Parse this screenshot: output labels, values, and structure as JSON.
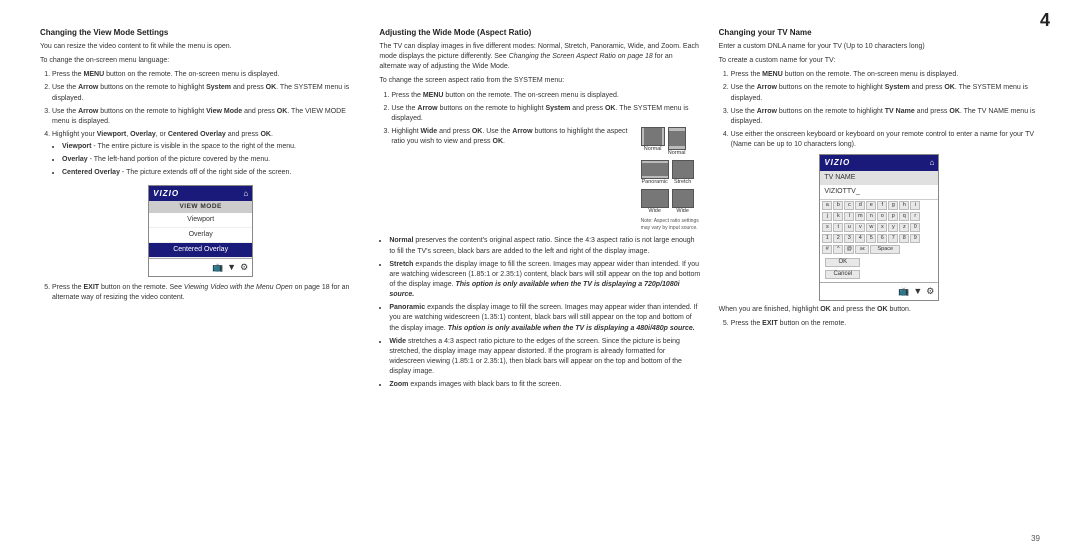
{
  "page": {
    "number": "4",
    "bottom_number": "39"
  },
  "col1": {
    "title": "Changing the View Mode Settings",
    "intro": "You can resize the video content to fit while the menu is open.",
    "change_lang": "To change the on-screen menu language:",
    "steps": [
      {
        "text": "Press the ",
        "bold": "MENU",
        "text2": " button on the remote. The on-screen menu is displayed."
      },
      {
        "text": "Use the ",
        "bold": "Arrow",
        "text2": " buttons on the remote to highlight ",
        "bold2": "System",
        "text3": " and press ",
        "bold3": "OK",
        "text4": ". The SYSTEM menu is displayed."
      },
      {
        "text": "Use the ",
        "bold": "Arrow",
        "text2": " buttons on the remote to highlight ",
        "bold2": "View Mode",
        "text3": " and press ",
        "bold3": "OK",
        "text4": ". The VIEW MODE menu is displayed."
      },
      {
        "text": "Highlight your ",
        "bold": "Viewport",
        "text2": ", ",
        "bold2": "Overlay",
        "text3": ", or ",
        "bold3": "Centered Overlay",
        "text4": " and press ",
        "bold4": "OK",
        "text5": "."
      }
    ],
    "bullets": [
      {
        "bold": "Viewport",
        "text": " - The entire picture is visible in the space to the right of the menu."
      },
      {
        "bold": "Overlay",
        "text": " - The left-hand portion of the picture covered by the menu."
      },
      {
        "bold": "Centered Overlay",
        "text": " - The picture extends off of the right side of the screen."
      }
    ],
    "step5": {
      "text": "Press the ",
      "bold": "EXIT",
      "text2": " button on the remote. See ",
      "italic": "Viewing Video with the Menu Open",
      "text3": " on page 18 for an alternate way of resizing the video content."
    },
    "menu": {
      "logo": "VIZIO",
      "title": "VIEW MODE",
      "items": [
        "Viewport",
        "Overlay",
        "Centered Overlay"
      ],
      "selected": "Centered Overlay"
    }
  },
  "col2": {
    "title": "Adjusting the Wide Mode (Aspect Ratio)",
    "intro": "The TV can display images in five different modes: Normal, Stretch, Panoramic, Wide, and Zoom. Each mode displays the picture differently. See Changing the Screen Aspect Ratio on page 18 for an alternate way of adjusting the Wide Mode.",
    "change_lang": "To change the screen aspect ratio from the SYSTEM menu:",
    "steps": [
      {
        "text": "Press the ",
        "bold": "MENU",
        "text2": " button on the remote. The on-screen menu is displayed."
      },
      {
        "text": "Use the ",
        "bold": "Arrow",
        "text2": " buttons on the remote to highlight ",
        "bold2": "System",
        "text3": " and press ",
        "bold3": "OK",
        "text4": ". The SYSTEM menu is displayed."
      },
      {
        "text": "Highlight ",
        "bold": "Wide",
        "text2": " and press ",
        "bold2": "OK",
        "text3": ". Use the ",
        "bold3": "Arrow",
        "text4": " buttons to highlight the aspect ratio you wish to view and press ",
        "bold4": "OK",
        "text5": "."
      }
    ],
    "bullets": [
      {
        "bold": "Normal",
        "text": " preserves the content's original aspect ratio. Since the 4:3 aspect ratio is not large enough to fill the TV's screen, black bars are added to the left and right of the display image."
      },
      {
        "bold": "Stretch",
        "text": " expands the display image to fill the screen. Images may appear wider than intended. If you are watching widescreen (1.85:1 or 2.35:1) content, black bars will still appear on the top and bottom of the display image. This option is only available when the TV is displaying a 720p/1080i source."
      },
      {
        "bold": "Panoramic",
        "text": " expands the display image to fill the screen. Images may appear wider than intended. If you are watching widescreen (1.35:1) content, black bars will still appear on the top and bottom of the display image. This option is only available when the TV is displaying a 480i/480p source."
      },
      {
        "bold": "Wide",
        "text": " stretches a 4:3 aspect ratio picture to the edges of the screen. Since the picture is being stretched, the display image may appear distorted. If the program is already formatted for widescreen viewing (1.85:1 or 2.35:1), then black bars will appear on the top and bottom of the display image."
      },
      {
        "bold": "Zoom",
        "text": " expands images with black bars to fit the screen."
      }
    ],
    "note": "Note: Aspect ratio settings may vary by input source.",
    "aspect_modes": [
      {
        "label": "Normal",
        "type": "normal"
      },
      {
        "label": "Normal",
        "type": "normal-tall"
      },
      {
        "label": "Panoramic",
        "type": "wide"
      },
      {
        "label": "Stretch",
        "type": "wide"
      },
      {
        "label": "Wide",
        "type": "wide"
      },
      {
        "label": "Wide",
        "type": "wide"
      }
    ]
  },
  "col3": {
    "title": "Changing your TV Name",
    "intro": "Enter a custom DNLA name for your TV (Up to 10 characters long)",
    "change_lang": "To create a custom name for your TV:",
    "steps": [
      {
        "text": "Press the ",
        "bold": "MENU",
        "text2": " button on the remote. The on-screen menu is displayed."
      },
      {
        "text": "Use the ",
        "bold": "Arrow",
        "text2": " buttons on the remote to highlight ",
        "bold2": "System",
        "text3": " and press ",
        "bold3": "OK",
        "text4": ". The SYSTEM menu is displayed."
      },
      {
        "text": "Use the ",
        "bold": "Arrow",
        "text2": " buttons on the remote to highlight ",
        "bold2": "TV Name",
        "text3": " and press ",
        "bold3": "OK",
        "text4": ". The TV NAME menu is displayed."
      },
      {
        "text": "Use either the onscreen keyboard or keyboard on your remote control to enter a name for your TV (Name can be up to 10 characters long)."
      }
    ],
    "finish_text": "When you are finished, highlight ",
    "finish_bold": "OK",
    "finish_text2": " and press the ",
    "finish_bold2": "OK",
    "finish_text3": " button.",
    "step5": {
      "text": "Press the ",
      "bold": "EXIT",
      "text2": " button on the remote."
    },
    "tv_name_menu": {
      "logo": "VIZIO",
      "title": "TV NAME",
      "input_value": "VIZIOTTV_",
      "kb_rows": [
        [
          "a",
          "b",
          "c",
          "d",
          "e",
          "f",
          "g",
          "h",
          "i"
        ],
        [
          "j",
          "k",
          "l",
          "m",
          "n",
          "o",
          "p",
          "q",
          "r"
        ],
        [
          "s",
          "t",
          "u",
          "v",
          "w",
          "x",
          "y",
          "z",
          "0"
        ],
        [
          "1",
          "2",
          "3",
          "4",
          "5",
          "6",
          "7",
          "8",
          "9"
        ],
        [
          "#",
          "^",
          "@",
          "ö€",
          "Space"
        ]
      ],
      "actions": [
        "OK",
        "Cancel"
      ]
    }
  }
}
